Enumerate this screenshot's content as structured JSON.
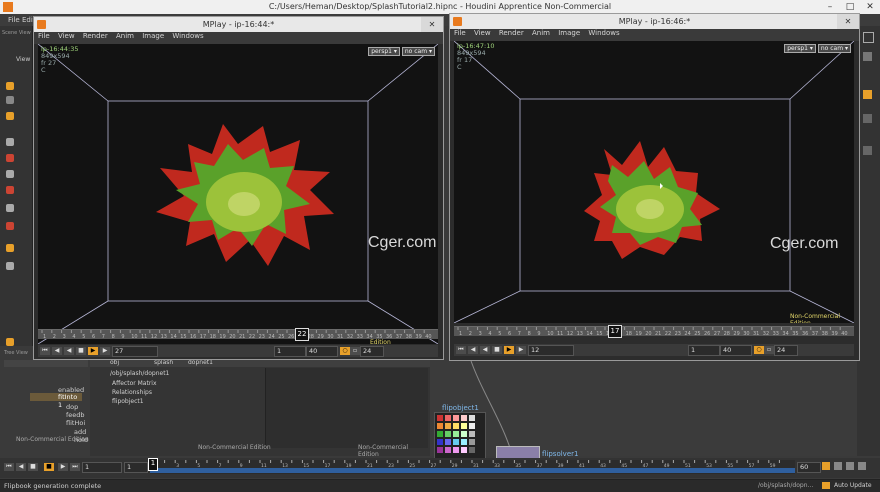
{
  "app": {
    "title": "C:/Users/Heman/Desktop/SplashTutorial2.hipnc - Houdini Apprentice Non-Commercial",
    "menu": [
      "File",
      "Edit"
    ],
    "window_buttons": [
      "–",
      "□",
      "✕"
    ]
  },
  "left_shelf": {
    "labels": [
      "Scene View",
      "View"
    ]
  },
  "mplay_left": {
    "title": "MPlay - ip-16:44:*",
    "menu": [
      "File",
      "View",
      "Render",
      "Anim",
      "Image",
      "Windows"
    ],
    "info_name": "ip-16:44:35",
    "info_res": "849x594",
    "info_frame": "fr 27",
    "info_c": "C",
    "cam_buttons": [
      "persp1 ▾",
      "no cam ▾"
    ],
    "watermark": "Cger.com",
    "nce": "Non-Commercial Edition",
    "ruler_numbers": [
      "1",
      "2",
      "3",
      "4",
      "5",
      "6",
      "7",
      "8",
      "9",
      "10",
      "11",
      "12",
      "13",
      "14",
      "15",
      "16",
      "17",
      "18",
      "19",
      "20",
      "21",
      "22",
      "23",
      "24",
      "25",
      "26",
      "27",
      "28",
      "29",
      "30",
      "31",
      "32",
      "33",
      "34",
      "35",
      "36",
      "37",
      "38",
      "39",
      "40"
    ],
    "current_frame": "22",
    "frame_field": "27",
    "range_start": "1",
    "range_end": "40",
    "fps": "24"
  },
  "mplay_right": {
    "title": "MPlay - ip-16:46:*",
    "menu": [
      "File",
      "View",
      "Render",
      "Anim",
      "Image",
      "Windows"
    ],
    "info_name": "ip-16:47:10",
    "info_res": "849x594",
    "info_frame": "fr 17",
    "info_c": "C",
    "cam_buttons": [
      "persp1 ▾",
      "no cam ▾"
    ],
    "watermark": "Cger.com",
    "nce": "Non-Commercial Edition",
    "current_frame": "17",
    "frame_field": "12",
    "range_start": "1",
    "range_end": "40",
    "fps": "24"
  },
  "tree_panel": {
    "header": "Tree View",
    "items": [
      "enabled",
      "fitInto 1",
      "dop",
      "feedb",
      "flitHoi",
      "add",
      "hold"
    ],
    "nce": "Non-Commercial Edition"
  },
  "net_panel": {
    "path_tabs": [
      "obj",
      "splash",
      "dopnet1"
    ],
    "path": "/obj/splash/dopnet1",
    "items": [
      "Affector Matrix",
      "Relationships",
      "flipobject1"
    ],
    "nce_left": "Non-Commercial Edition",
    "nce_right": "Non-Commercial Edition"
  },
  "node_area": {
    "node1": "flipobject1",
    "node2": "flipsolver1"
  },
  "timeline": {
    "frame_start_field": "1",
    "frame_field2": "1",
    "current": "1",
    "end_field": "60",
    "auto_update": "Auto Update",
    "numbers": [
      "1",
      "2",
      "3",
      "4",
      "5",
      "6",
      "7",
      "8",
      "9",
      "10",
      "11",
      "12",
      "13",
      "14",
      "15",
      "16",
      "17",
      "18",
      "19",
      "20",
      "21",
      "22",
      "23",
      "24",
      "25",
      "26",
      "27",
      "28",
      "29",
      "30",
      "31",
      "32",
      "33",
      "34",
      "35",
      "36",
      "37",
      "38",
      "39",
      "40",
      "41",
      "42",
      "43",
      "44",
      "45",
      "46",
      "47",
      "48",
      "49",
      "50",
      "51",
      "52",
      "53",
      "54",
      "55",
      "56",
      "57",
      "58",
      "59",
      "60"
    ]
  },
  "status": {
    "message": "Flipbook generation complete",
    "path": "/obj/splash/dopn..."
  },
  "colors": {
    "accent": "#e8a02a",
    "houdini_orange": "#e87a1e",
    "particle_green": "#4caa2a",
    "particle_red": "#d42c20"
  }
}
